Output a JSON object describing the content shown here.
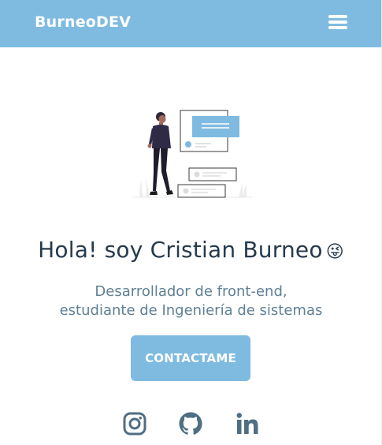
{
  "navbar": {
    "brand": "BurneoDEV",
    "menu_icon": "hamburger-menu-icon"
  },
  "hero": {
    "illustration_icon": "person-with-cards-illustration",
    "title": "Hola! soy Cristian Burneo",
    "title_emoji": "😜",
    "subtitle_line1": "Desarrollador de front-end,",
    "subtitle_line2": "estudiante de Ingeniería de sistemas",
    "cta_label": "CONTACTAME"
  },
  "social": [
    {
      "icon": "instagram-icon"
    },
    {
      "icon": "github-icon"
    },
    {
      "icon": "linkedin-icon"
    }
  ],
  "colors": {
    "accent": "#7fbbe0",
    "heading": "#263a4d",
    "subtitle": "#5f7f95",
    "icon": "#4f6e83"
  }
}
